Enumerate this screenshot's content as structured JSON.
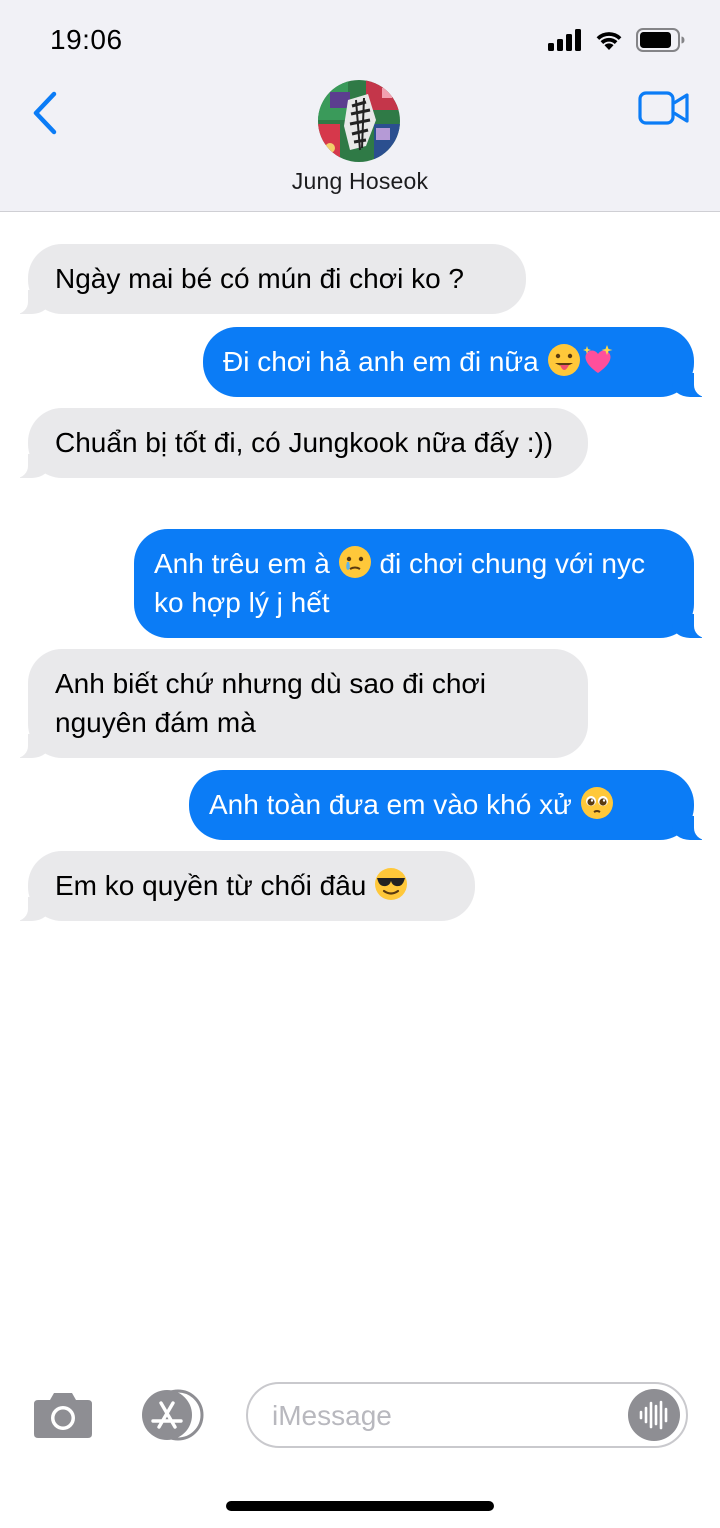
{
  "status_bar": {
    "time": "19:06"
  },
  "header": {
    "contact_name": "Jung Hoseok"
  },
  "messages": [
    {
      "direction": "in",
      "text": "Ngày mai bé có mún đi chơi ko ?",
      "emojis": []
    },
    {
      "direction": "out",
      "text": "Đi chơi hả anh em đi nữa",
      "emojis": [
        "face-tongue-emoji",
        "sparkling-heart-emoji"
      ]
    },
    {
      "direction": "in",
      "text": "Chuẩn bị tốt đi, có Jungkook nữa đấy :))",
      "emojis": []
    },
    {
      "direction": "out",
      "text_before": "Anh trêu em à",
      "text_after": "đi chơi chung với nyc ko hợp lý j hết",
      "emojis": [
        "holding-back-tears-emoji"
      ]
    },
    {
      "direction": "in",
      "text": "Anh biết chứ nhưng dù sao đi chơi nguyên đám mà",
      "emojis": []
    },
    {
      "direction": "out",
      "text": "Anh toàn đưa em vào khó xử",
      "emojis": [
        "pleading-face-emoji"
      ]
    },
    {
      "direction": "in",
      "text": "Em ko quyền từ chối đâu",
      "emojis": [
        "sunglasses-face-emoji"
      ]
    }
  ],
  "composer": {
    "placeholder": "iMessage",
    "value": ""
  },
  "colors": {
    "incoming_bubble": "#e9e9eb",
    "outgoing_bubble": "#0b7cf6",
    "accent": "#0b7cf6",
    "header_bg": "#f1f1f6"
  },
  "icons": [
    "signal-icon",
    "wifi-icon",
    "battery-icon",
    "back-chevron-icon",
    "video-call-icon",
    "camera-icon",
    "app-store-icon",
    "audio-waveform-icon"
  ]
}
